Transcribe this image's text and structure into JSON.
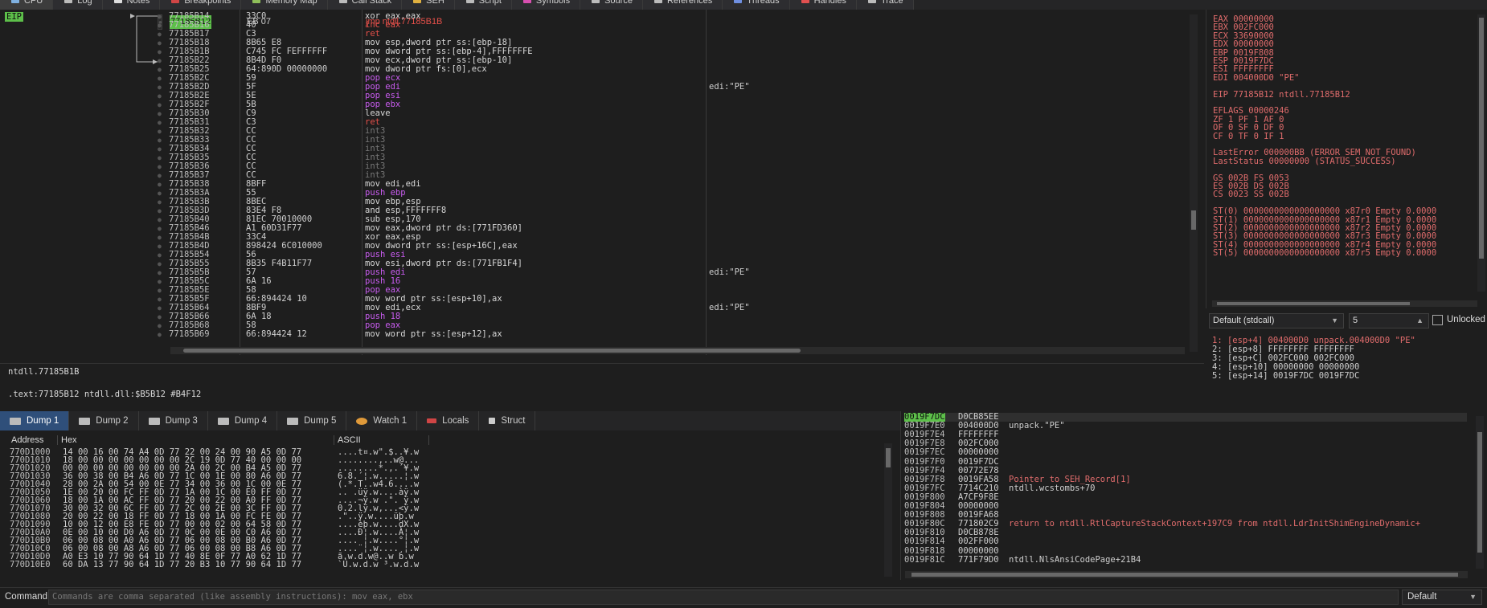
{
  "tabs": [
    {
      "label": "CPU",
      "color": "#7fb0e0"
    },
    {
      "label": "Log",
      "color": "#bbbbbb"
    },
    {
      "label": "Notes",
      "color": "#dddddd"
    },
    {
      "label": "Breakpoints",
      "color": "#d04545"
    },
    {
      "label": "Memory Map",
      "color": "#8fbf5a"
    },
    {
      "label": "Call Stack",
      "color": "#bbbbbb"
    },
    {
      "label": "SEH",
      "color": "#e0b040"
    },
    {
      "label": "Script",
      "color": "#bbbbbb"
    },
    {
      "label": "Symbols",
      "color": "#d84fb0"
    },
    {
      "label": "Source",
      "color": "#bbbbbb"
    },
    {
      "label": "References",
      "color": "#bbbbbb"
    },
    {
      "label": "Threads",
      "color": "#6f8fe0"
    },
    {
      "label": "Handles",
      "color": "#e05050"
    },
    {
      "label": "Trace",
      "color": "#bbbbbb"
    }
  ],
  "eip_label": "EIP",
  "disasm": [
    {
      "addr": "77185B12",
      "bytes": "EB 07",
      "instr": "jmp ntdll.77185B1B",
      "cmt": ""
    },
    {
      "addr": "77185B14",
      "bytes": "33C0",
      "instr": "xor eax,eax",
      "cmt": ""
    },
    {
      "addr": "77185B16",
      "bytes": "40",
      "instr": "inc eax",
      "cmt": ""
    },
    {
      "addr": "77185B17",
      "bytes": "C3",
      "instr": "ret",
      "cmt": ""
    },
    {
      "addr": "77185B18",
      "bytes": "8B65 E8",
      "instr": "mov esp,dword ptr ss:[ebp-18]",
      "cmt": ""
    },
    {
      "addr": "77185B1B",
      "bytes": "C745 FC FEFFFFFF",
      "instr": "mov dword ptr ss:[ebp-4],FFFFFFFE",
      "cmt": ""
    },
    {
      "addr": "77185B22",
      "bytes": "8B4D F0",
      "instr": "mov ecx,dword ptr ss:[ebp-10]",
      "cmt": ""
    },
    {
      "addr": "77185B25",
      "bytes": "64:890D 00000000",
      "instr": "mov dword ptr fs:[0],ecx",
      "cmt": ""
    },
    {
      "addr": "77185B2C",
      "bytes": "59",
      "instr": "pop ecx",
      "cmt": ""
    },
    {
      "addr": "77185B2D",
      "bytes": "5F",
      "instr": "pop edi",
      "cmt": "edi:\"PE\""
    },
    {
      "addr": "77185B2E",
      "bytes": "5E",
      "instr": "pop esi",
      "cmt": ""
    },
    {
      "addr": "77185B2F",
      "bytes": "5B",
      "instr": "pop ebx",
      "cmt": ""
    },
    {
      "addr": "77185B30",
      "bytes": "C9",
      "instr": "leave",
      "cmt": ""
    },
    {
      "addr": "77185B31",
      "bytes": "C3",
      "instr": "ret",
      "cmt": ""
    },
    {
      "addr": "77185B32",
      "bytes": "CC",
      "instr": "int3",
      "cmt": ""
    },
    {
      "addr": "77185B33",
      "bytes": "CC",
      "instr": "int3",
      "cmt": ""
    },
    {
      "addr": "77185B34",
      "bytes": "CC",
      "instr": "int3",
      "cmt": ""
    },
    {
      "addr": "77185B35",
      "bytes": "CC",
      "instr": "int3",
      "cmt": ""
    },
    {
      "addr": "77185B36",
      "bytes": "CC",
      "instr": "int3",
      "cmt": ""
    },
    {
      "addr": "77185B37",
      "bytes": "CC",
      "instr": "int3",
      "cmt": ""
    },
    {
      "addr": "77185B38",
      "bytes": "8BFF",
      "instr": "mov edi,edi",
      "cmt": ""
    },
    {
      "addr": "77185B3A",
      "bytes": "55",
      "instr": "push ebp",
      "cmt": ""
    },
    {
      "addr": "77185B3B",
      "bytes": "8BEC",
      "instr": "mov ebp,esp",
      "cmt": ""
    },
    {
      "addr": "77185B3D",
      "bytes": "83E4 F8",
      "instr": "and esp,FFFFFFF8",
      "cmt": ""
    },
    {
      "addr": "77185B40",
      "bytes": "81EC 70010000",
      "instr": "sub esp,170",
      "cmt": ""
    },
    {
      "addr": "77185B46",
      "bytes": "A1 60D31F77",
      "instr": "mov eax,dword ptr ds:[771FD360]",
      "cmt": ""
    },
    {
      "addr": "77185B4B",
      "bytes": "33C4",
      "instr": "xor eax,esp",
      "cmt": ""
    },
    {
      "addr": "77185B4D",
      "bytes": "898424 6C010000",
      "instr": "mov dword ptr ss:[esp+16C],eax",
      "cmt": ""
    },
    {
      "addr": "77185B54",
      "bytes": "56",
      "instr": "push esi",
      "cmt": ""
    },
    {
      "addr": "77185B55",
      "bytes": "8B35 F4B11F77",
      "instr": "mov esi,dword ptr ds:[771FB1F4]",
      "cmt": ""
    },
    {
      "addr": "77185B5B",
      "bytes": "57",
      "instr": "push edi",
      "cmt": "edi:\"PE\""
    },
    {
      "addr": "77185B5C",
      "bytes": "6A 16",
      "instr": "push 16",
      "cmt": ""
    },
    {
      "addr": "77185B5E",
      "bytes": "58",
      "instr": "pop eax",
      "cmt": ""
    },
    {
      "addr": "77185B5F",
      "bytes": "66:894424 10",
      "instr": "mov word ptr ss:[esp+10],ax",
      "cmt": ""
    },
    {
      "addr": "77185B64",
      "bytes": "8BF9",
      "instr": "mov edi,ecx",
      "cmt": "edi:\"PE\""
    },
    {
      "addr": "77185B66",
      "bytes": "6A 18",
      "instr": "push 18",
      "cmt": ""
    },
    {
      "addr": "77185B68",
      "bytes": "58",
      "instr": "pop eax",
      "cmt": ""
    },
    {
      "addr": "77185B69",
      "bytes": "66:894424 12",
      "instr": "mov word ptr ss:[esp+12],ax",
      "cmt": ""
    }
  ],
  "info_line1": "ntdll.77185B1B",
  "info_line2": ".text:77185B12 ntdll.dll:$B5B12 #B4F12",
  "registers": [
    "EAX   00000000",
    "EBX   002FC000",
    "ECX   33690000",
    "EDX   00000000",
    "EBP   0019F808",
    "ESP   0019F7DC",
    "ESI   FFFFFFFF",
    "EDI   004000D0     \"PE\"",
    "",
    "EIP   77185B12     ntdll.77185B12",
    "",
    "EFLAGS   00000246",
    "ZF 1  PF 1  AF 0",
    "OF 0  SF 0  DF 0",
    "CF 0  TF 0  IF 1",
    "",
    "LastError  000000BB (ERROR_SEM_NOT_FOUND)",
    "LastStatus 00000000 (STATUS_SUCCESS)",
    "",
    "GS 002B  FS 0053",
    "ES 002B  DS 002B",
    "CS 0023  SS 002B",
    "",
    "ST(0) 0000000000000000000 x87r0 Empty 0.0000",
    "ST(1) 0000000000000000000 x87r1 Empty 0.0000",
    "ST(2) 0000000000000000000 x87r2 Empty 0.0000",
    "ST(3) 0000000000000000000 x87r3 Empty 0.0000",
    "ST(4) 0000000000000000000 x87r4 Empty 0.0000",
    "ST(5) 0000000000000000000 x87r5 Empty 0.0000"
  ],
  "callconv": "Default (stdcall)",
  "argcount": "5",
  "unlocked_label": "Unlocked",
  "stack_args": [
    "1: [esp+4] 004000D0 unpack.004000D0 \"PE\"",
    "2: [esp+8] FFFFFFFF FFFFFFFF",
    "3: [esp+C] 002FC000 002FC000",
    "4: [esp+10] 00000000 00000000",
    "5: [esp+14] 0019F7DC 0019F7DC"
  ],
  "dump_tabs": [
    {
      "label": "Dump 1",
      "icon": "d"
    },
    {
      "label": "Dump 2",
      "icon": "d"
    },
    {
      "label": "Dump 3",
      "icon": "d"
    },
    {
      "label": "Dump 4",
      "icon": "d"
    },
    {
      "label": "Dump 5",
      "icon": "d"
    },
    {
      "label": "Watch 1",
      "icon": "w"
    },
    {
      "label": "Locals",
      "icon": "l"
    },
    {
      "label": "Struct",
      "icon": "s"
    }
  ],
  "dump_headers": {
    "address": "Address",
    "hex": "Hex",
    "ascii": "ASCII"
  },
  "dump": [
    {
      "addr": "770D1000",
      "hex": "14 00 16 00 74 A4 0D 77 22 00 24 00 90 A5 0D 77",
      "ascii": "....t¤.w\".$..¥.w"
    },
    {
      "addr": "770D1010",
      "hex": "18 00 00 00 00 00 00 00 2C 19 0D 77 40 00 00 00",
      "ascii": "........,..w@..."
    },
    {
      "addr": "770D1020",
      "hex": "00 00 00 00 00 00 00 00 2A 00 2C 00 B4 A5 0D 77",
      "ascii": "........*.,.´¥.w"
    },
    {
      "addr": "770D1030",
      "hex": "36 00 38 00 B4 A6 0D 77 1C 00 1E 00 80 A6 0D 77",
      "ascii": "6.8.´¦.w.....¦.w"
    },
    {
      "addr": "770D1040",
      "hex": "28 00 2A 00 54 00 0E 77 34 00 36 00 1C 00 0E 77",
      "ascii": "(.*.T..w4.6....w"
    },
    {
      "addr": "770D1050",
      "hex": "1E 00 20 00 FC FF 0D 77 1A 00 1C 00 E0 FF 0D 77",
      "ascii": ".. .üÿ.w....àÿ.w"
    },
    {
      "addr": "770D1060",
      "hex": "18 00 1A 00 AC FF 0D 77 20 00 22 00 A0 FF 0D 77",
      "ascii": "....¬ÿ.w .\". ÿ.w"
    },
    {
      "addr": "770D1070",
      "hex": "30 00 32 00 6C FF 0D 77 2C 00 2E 00 3C FF 0D 77",
      "ascii": "0.2.lÿ.w,...<ÿ.w"
    },
    {
      "addr": "770D1080",
      "hex": "20 00 22 00 18 FF 0D 77 18 00 1A 00 FC FE 0D 77",
      "ascii": " .\"..ÿ.w....üþ.w"
    },
    {
      "addr": "770D1090",
      "hex": "10 00 12 00 E8 FE 0D 77 00 00 02 00 64 58 0D 77",
      "ascii": "....èþ.w....dX.w"
    },
    {
      "addr": "770D10A0",
      "hex": "0E 00 10 00 D0 A6 0D 77 0C 00 0E 00 C0 A6 0D 77",
      "ascii": "....Ð¦.w....À¦.w"
    },
    {
      "addr": "770D10B0",
      "hex": "06 00 08 00 A0 A6 0D 77 06 00 08 00 B0 A6 0D 77",
      "ascii": ".... ¦.w....°¦.w"
    },
    {
      "addr": "770D10C0",
      "hex": "06 00 08 00 A8 A6 0D 77 06 00 08 00 B8 A6 0D 77",
      "ascii": "....¨¦.w....¸¦.w"
    },
    {
      "addr": "770D10D0",
      "hex": "A0 E3 10 77 90 64 1D 77 40 8E 0F 77 A0 62 1D 77",
      "ascii": " ã.w.d.w@..w b.w"
    },
    {
      "addr": "770D10E0",
      "hex": "60 DA 13 77 90 64 1D 77 20 B3 10 77 90 64 1D 77",
      "ascii": "`Ú.w.d.w ³.w.d.w"
    }
  ],
  "stack": [
    {
      "addr": "0019F7DC",
      "val": "D0CB85EE",
      "cmt": "",
      "red": false
    },
    {
      "addr": "0019F7E0",
      "val": "004000D0",
      "cmt": "unpack.\"PE\"",
      "red": false
    },
    {
      "addr": "0019F7E4",
      "val": "FFFFFFFF",
      "cmt": "",
      "red": false
    },
    {
      "addr": "0019F7E8",
      "val": "002FC000",
      "cmt": "",
      "red": false
    },
    {
      "addr": "0019F7EC",
      "val": "00000000",
      "cmt": "",
      "red": false
    },
    {
      "addr": "0019F7F0",
      "val": "0019F7DC",
      "cmt": "",
      "red": false
    },
    {
      "addr": "0019F7F4",
      "val": "00772E78",
      "cmt": "",
      "red": false
    },
    {
      "addr": "0019F7F8",
      "val": "0019FA58",
      "cmt": "Pointer to SEH_Record[1]",
      "red": true
    },
    {
      "addr": "0019F7FC",
      "val": "7714C210",
      "cmt": "ntdll.wcstombs+70",
      "red": false
    },
    {
      "addr": "0019F800",
      "val": "A7CF9F8E",
      "cmt": "",
      "red": false
    },
    {
      "addr": "0019F804",
      "val": "00000000",
      "cmt": "",
      "red": false
    },
    {
      "addr": "0019F808",
      "val": "0019FA68",
      "cmt": "",
      "red": false
    },
    {
      "addr": "0019F80C",
      "val": "771802C9",
      "cmt": "return to ntdll.RtlCaptureStackContext+197C9 from ntdll.LdrInitShimEngineDynamic+",
      "red": true
    },
    {
      "addr": "0019F810",
      "val": "D0CB878E",
      "cmt": "",
      "red": false
    },
    {
      "addr": "0019F814",
      "val": "002FF000",
      "cmt": "",
      "red": false
    },
    {
      "addr": "0019F818",
      "val": "00000000",
      "cmt": "",
      "red": false
    },
    {
      "addr": "0019F81C",
      "val": "771F79D0",
      "cmt": "ntdll.NlsAnsiCodePage+21B4",
      "red": false
    }
  ],
  "command_label": "Command:",
  "command_placeholder": "Commands are comma separated (like assembly instructions): mov eax, ebx",
  "command_mode": "Default"
}
